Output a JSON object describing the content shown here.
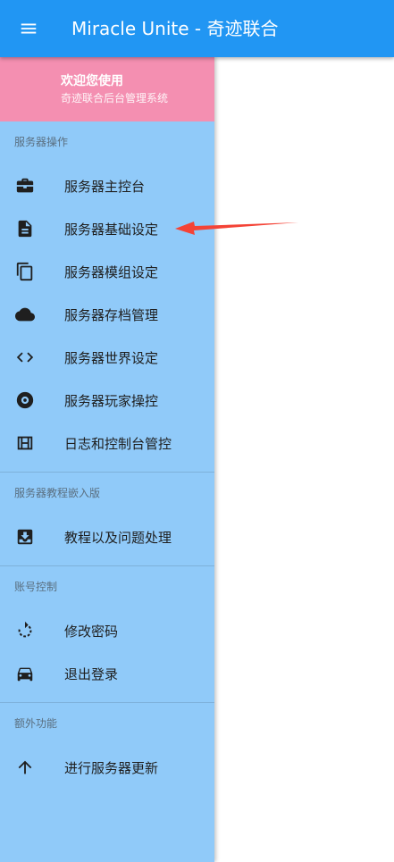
{
  "app_bar": {
    "title": "Miracle Unite - 奇迹联合",
    "menu_icon": "menu-icon",
    "color": "#2196f3"
  },
  "drawer": {
    "background": "#90caf9",
    "header": {
      "title": "欢迎您使用",
      "subtitle": "奇迹联合后台管理系统",
      "color": "#f48fb1"
    },
    "sections": [
      {
        "header": "服务器操作",
        "items": [
          {
            "label": "服务器主控台",
            "icon": "briefcase-icon"
          },
          {
            "label": "服务器基础设定",
            "icon": "document-icon"
          },
          {
            "label": "服务器模组设定",
            "icon": "copy-icon"
          },
          {
            "label": "服务器存档管理",
            "icon": "cloud-icon"
          },
          {
            "label": "服务器世界设定",
            "icon": "code-icon"
          },
          {
            "label": "服务器玩家操控",
            "icon": "disc-icon"
          },
          {
            "label": "日志和控制台管控",
            "icon": "calendar-view-icon"
          }
        ]
      },
      {
        "header": "服务器教程嵌入版",
        "items": [
          {
            "label": "教程以及问题处理",
            "icon": "inbox-download-icon"
          }
        ]
      },
      {
        "header": "账号控制",
        "items": [
          {
            "label": "修改密码",
            "icon": "rotate-dashed-icon"
          },
          {
            "label": "退出登录",
            "icon": "car-icon"
          }
        ]
      },
      {
        "header": "额外功能",
        "items": [
          {
            "label": "进行服务器更新",
            "icon": "arrow-up-icon"
          }
        ]
      }
    ]
  },
  "annotation": {
    "arrow_icon": "red-arrow-icon",
    "color": "#f44336"
  }
}
